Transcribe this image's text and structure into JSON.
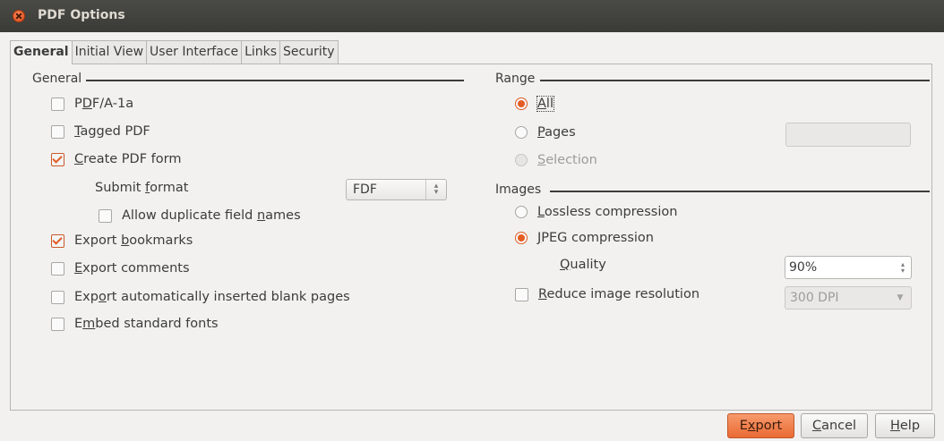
{
  "window": {
    "title": "PDF Options"
  },
  "tabs": [
    "General",
    "Initial View",
    "User Interface",
    "Links",
    "Security"
  ],
  "general": {
    "heading": "General",
    "pdfa": {
      "pre": "P",
      "u": "D",
      "post": "F/A-1a",
      "checked": false
    },
    "tagged": {
      "pre": "",
      "u": "T",
      "post": "agged PDF",
      "checked": false
    },
    "create_form": {
      "pre": "",
      "u": "C",
      "post": "reate PDF form",
      "checked": true
    },
    "submit_format": {
      "pre": "Submit ",
      "u": "f",
      "post": "ormat",
      "value": "FDF"
    },
    "allow_dup": {
      "pre": "Allow duplicate field ",
      "u": "n",
      "post": "ames",
      "checked": false
    },
    "bookmarks": {
      "pre": "Export ",
      "u": "b",
      "post": "ookmarks",
      "checked": true
    },
    "comments": {
      "pre": "",
      "u": "E",
      "post": "xport comments",
      "checked": false
    },
    "blank_pages": {
      "pre": "Exp",
      "u": "o",
      "post": "rt automatically inserted blank pages",
      "checked": false
    },
    "embed_fonts": {
      "pre": "E",
      "u": "m",
      "post": "bed standard fonts",
      "checked": false
    }
  },
  "range": {
    "heading": "Range",
    "all": {
      "pre": "",
      "u": "A",
      "post": "ll",
      "selected": true
    },
    "pages": {
      "pre": "",
      "u": "P",
      "post": "ages",
      "selected": false,
      "value": ""
    },
    "selection": {
      "pre": "",
      "u": "S",
      "post": "election",
      "selected": false,
      "disabled": true
    }
  },
  "images": {
    "heading": "Images",
    "lossless": {
      "pre": "",
      "u": "L",
      "post": "ossless compression",
      "selected": false
    },
    "jpeg": {
      "pre": "",
      "u": "J",
      "post": "PEG compression",
      "selected": true
    },
    "quality": {
      "pre": "",
      "u": "Q",
      "post": "uality",
      "value": "90%"
    },
    "reduce": {
      "pre": "",
      "u": "R",
      "post": "educe image resolution",
      "checked": false,
      "value": "300 DPI"
    }
  },
  "buttons": {
    "export": {
      "pre": "E",
      "u": "x",
      "post": "port"
    },
    "cancel": {
      "pre": "",
      "u": "C",
      "post": "ancel"
    },
    "help": {
      "pre": "",
      "u": "H",
      "post": "elp"
    }
  },
  "colors": {
    "accent": "#e55d24",
    "titlebar": "#3c3b37",
    "background": "#f2f1f0"
  }
}
